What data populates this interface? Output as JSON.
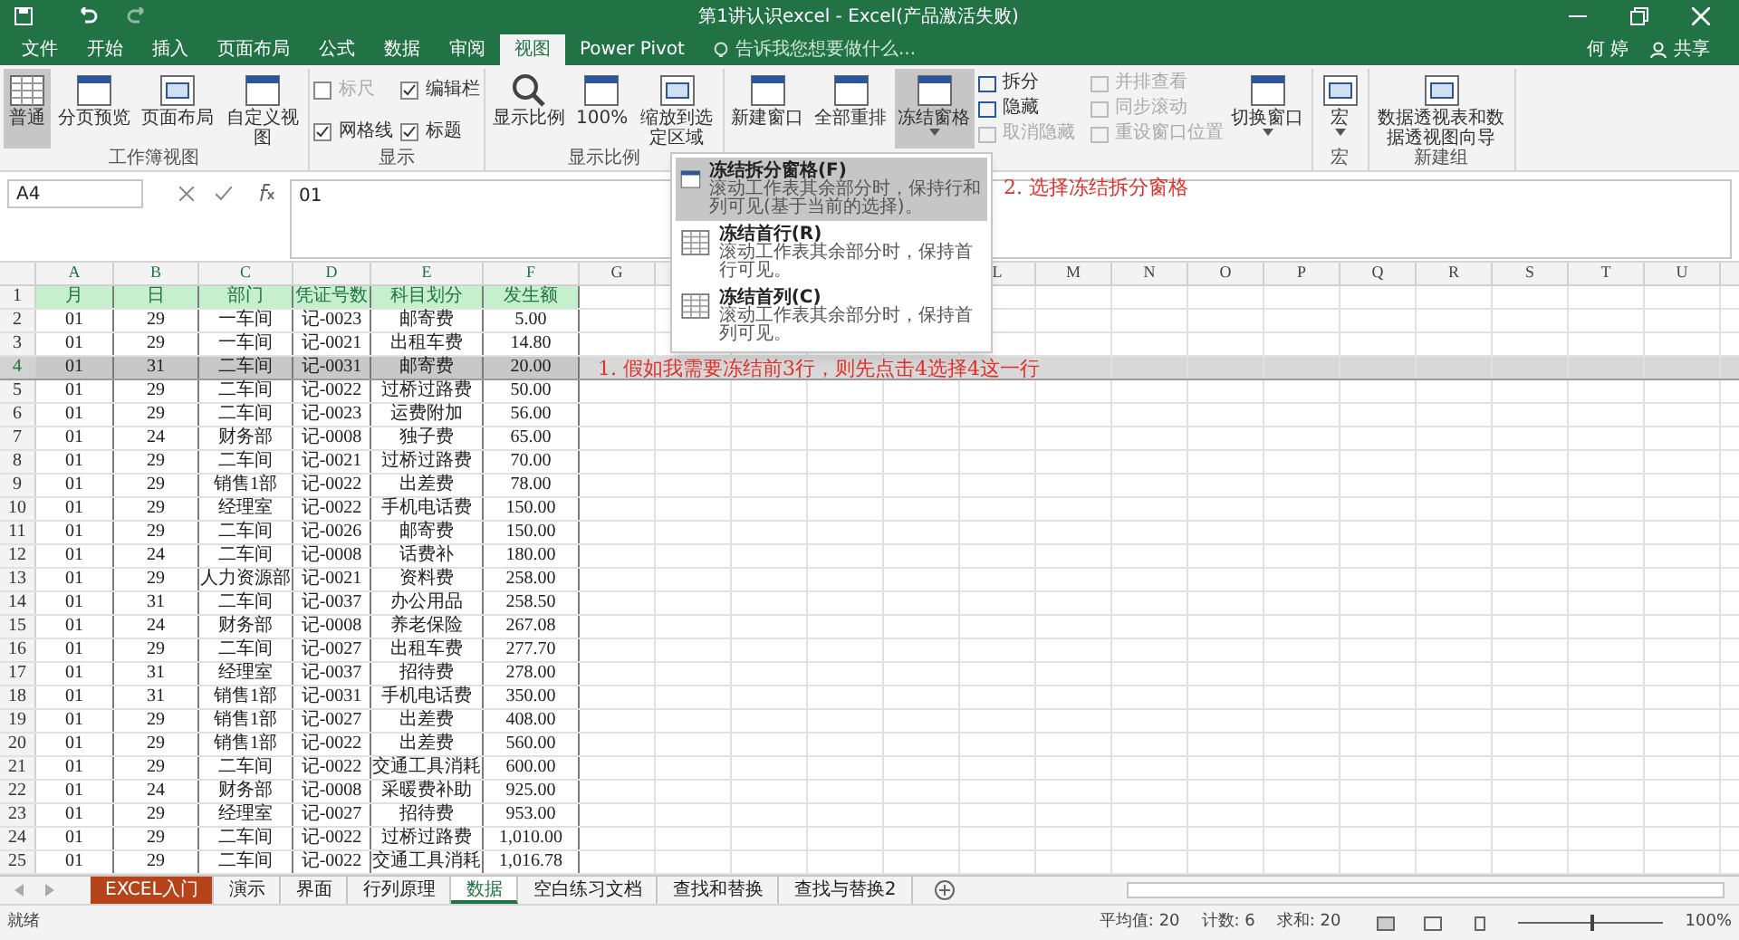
{
  "title_bar": {
    "title": "第1讲认识excel - Excel(产品激活失败)",
    "user": "何 婷",
    "share": "共享"
  },
  "menu_tabs": [
    {
      "label": "文件",
      "selected": false
    },
    {
      "label": "开始",
      "selected": false
    },
    {
      "label": "插入",
      "selected": false
    },
    {
      "label": "页面布局",
      "selected": false
    },
    {
      "label": "公式",
      "selected": false
    },
    {
      "label": "数据",
      "selected": false
    },
    {
      "label": "审阅",
      "selected": false
    },
    {
      "label": "视图",
      "selected": true
    },
    {
      "label": "Power Pivot",
      "selected": false
    }
  ],
  "tell_me": {
    "placeholder": "告诉我您想要做什么..."
  },
  "ribbon_groups": [
    {
      "label": "工作簿视图",
      "items": [
        {
          "kind": "large",
          "label": "普通",
          "selected": true
        },
        {
          "kind": "large",
          "label": "分页预览",
          "selected": false
        },
        {
          "kind": "large",
          "label": "页面布局",
          "selected": false
        },
        {
          "kind": "large",
          "label": "自定义视图",
          "selected": false
        }
      ]
    },
    {
      "label": "显示",
      "items": [
        {
          "kind": "check",
          "label": "标尺",
          "checked": false,
          "disabled": true
        },
        {
          "kind": "check",
          "label": "编辑栏",
          "checked": true,
          "disabled": false
        },
        {
          "kind": "check",
          "label": "网格线",
          "checked": true,
          "disabled": false
        },
        {
          "kind": "check",
          "label": "标题",
          "checked": true,
          "disabled": false
        }
      ]
    },
    {
      "label": "显示比例",
      "items": [
        {
          "kind": "large",
          "label": "显示比例",
          "selected": false
        },
        {
          "kind": "large",
          "label": "100%",
          "selected": false
        },
        {
          "kind": "large",
          "label": "缩放到选定区域",
          "selected": false
        }
      ]
    },
    {
      "items": [
        {
          "kind": "large",
          "label": "新建窗口",
          "selected": false
        },
        {
          "kind": "large",
          "label": "全部重排",
          "selected": false
        },
        {
          "kind": "large",
          "label": "冻结窗格",
          "selected": true,
          "has_menu": true
        },
        {
          "kind": "small",
          "label": "拆分",
          "disabled": false
        },
        {
          "kind": "small",
          "label": "隐藏",
          "disabled": false
        },
        {
          "kind": "small",
          "label": "取消隐藏",
          "disabled": true
        },
        {
          "kind": "small",
          "label": "并排查看",
          "disabled": true
        },
        {
          "kind": "small",
          "label": "同步滚动",
          "disabled": true
        },
        {
          "kind": "small",
          "label": "重设窗口位置",
          "disabled": true
        },
        {
          "kind": "large",
          "label": "切换窗口",
          "selected": false,
          "has_menu": true
        }
      ]
    },
    {
      "label": "宏",
      "items": [
        {
          "kind": "large",
          "label": "宏",
          "selected": false,
          "has_menu": true
        }
      ]
    },
    {
      "label": "新建组",
      "items": [
        {
          "kind": "large",
          "label": "数据透视表和数据透视图向导",
          "selected": false
        }
      ]
    }
  ],
  "formula_bar": {
    "name_box": "A4",
    "value": "01"
  },
  "columns": [
    "A",
    "B",
    "C",
    "D",
    "E",
    "F",
    "G",
    "L",
    "M",
    "N",
    "O",
    "P",
    "Q",
    "R",
    "S",
    "T",
    "U"
  ],
  "rows": [
    {
      "number": "1",
      "kind": "header",
      "selected": false,
      "cells": [
        "月",
        "日",
        "部门",
        "凭证号数",
        "科目划分",
        "发生额"
      ]
    },
    {
      "number": "2",
      "kind": "data",
      "selected": false,
      "cells": [
        "01",
        "29",
        "一车间",
        "记-0023",
        "邮寄费",
        "5.00"
      ]
    },
    {
      "number": "3",
      "kind": "data",
      "selected": false,
      "cells": [
        "01",
        "29",
        "一车间",
        "记-0021",
        "出租车费",
        "14.80"
      ]
    },
    {
      "number": "4",
      "kind": "data",
      "selected": true,
      "cells": [
        "01",
        "31",
        "二车间",
        "记-0031",
        "邮寄费",
        "20.00"
      ]
    },
    {
      "number": "5",
      "kind": "data",
      "selected": false,
      "cells": [
        "01",
        "29",
        "二车间",
        "记-0022",
        "过桥过路费",
        "50.00"
      ]
    },
    {
      "number": "6",
      "kind": "data",
      "selected": false,
      "cells": [
        "01",
        "29",
        "二车间",
        "记-0023",
        "运费附加",
        "56.00"
      ]
    },
    {
      "number": "7",
      "kind": "data",
      "selected": false,
      "cells": [
        "01",
        "24",
        "财务部",
        "记-0008",
        "独子费",
        "65.00"
      ]
    },
    {
      "number": "8",
      "kind": "data",
      "selected": false,
      "cells": [
        "01",
        "29",
        "二车间",
        "记-0021",
        "过桥过路费",
        "70.00"
      ]
    },
    {
      "number": "9",
      "kind": "data",
      "selected": false,
      "cells": [
        "01",
        "29",
        "销售1部",
        "记-0022",
        "出差费",
        "78.00"
      ]
    },
    {
      "number": "10",
      "kind": "data",
      "selected": false,
      "cells": [
        "01",
        "29",
        "经理室",
        "记-0022",
        "手机电话费",
        "150.00"
      ]
    },
    {
      "number": "11",
      "kind": "data",
      "selected": false,
      "cells": [
        "01",
        "29",
        "二车间",
        "记-0026",
        "邮寄费",
        "150.00"
      ]
    },
    {
      "number": "12",
      "kind": "data",
      "selected": false,
      "cells": [
        "01",
        "24",
        "二车间",
        "记-0008",
        "话费补",
        "180.00"
      ]
    },
    {
      "number": "13",
      "kind": "data",
      "selected": false,
      "cells": [
        "01",
        "29",
        "人力资源部",
        "记-0021",
        "资料费",
        "258.00"
      ]
    },
    {
      "number": "14",
      "kind": "data",
      "selected": false,
      "cells": [
        "01",
        "31",
        "二车间",
        "记-0037",
        "办公用品",
        "258.50"
      ]
    },
    {
      "number": "15",
      "kind": "data",
      "selected": false,
      "cells": [
        "01",
        "24",
        "财务部",
        "记-0008",
        "养老保险",
        "267.08"
      ]
    },
    {
      "number": "16",
      "kind": "data",
      "selected": false,
      "cells": [
        "01",
        "29",
        "二车间",
        "记-0027",
        "出租车费",
        "277.70"
      ]
    },
    {
      "number": "17",
      "kind": "data",
      "selected": false,
      "cells": [
        "01",
        "31",
        "经理室",
        "记-0037",
        "招待费",
        "278.00"
      ]
    },
    {
      "number": "18",
      "kind": "data",
      "selected": false,
      "cells": [
        "01",
        "31",
        "销售1部",
        "记-0031",
        "手机电话费",
        "350.00"
      ]
    },
    {
      "number": "19",
      "kind": "data",
      "selected": false,
      "cells": [
        "01",
        "29",
        "销售1部",
        "记-0027",
        "出差费",
        "408.00"
      ]
    },
    {
      "number": "20",
      "kind": "data",
      "selected": false,
      "cells": [
        "01",
        "29",
        "销售1部",
        "记-0022",
        "出差费",
        "560.00"
      ]
    },
    {
      "number": "21",
      "kind": "data",
      "selected": false,
      "cells": [
        "01",
        "29",
        "二车间",
        "记-0022",
        "交通工具消耗",
        "600.00"
      ]
    },
    {
      "number": "22",
      "kind": "data",
      "selected": false,
      "cells": [
        "01",
        "24",
        "财务部",
        "记-0008",
        "采暖费补助",
        "925.00"
      ]
    },
    {
      "number": "23",
      "kind": "data",
      "selected": false,
      "cells": [
        "01",
        "29",
        "经理室",
        "记-0027",
        "招待费",
        "953.00"
      ]
    },
    {
      "number": "24",
      "kind": "data",
      "selected": false,
      "cells": [
        "01",
        "29",
        "二车间",
        "记-0022",
        "过桥过路费",
        "1,010.00"
      ]
    },
    {
      "number": "25",
      "kind": "data",
      "selected": false,
      "cells": [
        "01",
        "29",
        "二车间",
        "记-0022",
        "交通工具消耗",
        "1,016.78"
      ]
    }
  ],
  "freeze_menu": {
    "items": [
      {
        "label": "冻结拆分窗格(F)",
        "description": "滚动工作表其余部分时，保持行和列可见(基于当前的选择)。",
        "selected": true
      },
      {
        "label": "冻结首行(R)",
        "description": "滚动工作表其余部分时，保持首行可见。",
        "selected": false
      },
      {
        "label": "冻结首列(C)",
        "description": "滚动工作表其余部分时，保持首列可见。",
        "selected": false
      }
    ]
  },
  "annotations": [
    "2. 选择冻结拆分窗格",
    "1. 假如我需要冻结前3行，则先点击4选择4这一行"
  ],
  "sheet_tabs": [
    {
      "label": "EXCEL入门",
      "selected": false,
      "color": "#b5441b"
    },
    {
      "label": "演示",
      "selected": false
    },
    {
      "label": "界面",
      "selected": false
    },
    {
      "label": "行列原理",
      "selected": false
    },
    {
      "label": "数据",
      "selected": true
    },
    {
      "label": "空白练习文档",
      "selected": false
    },
    {
      "label": "查找和替换",
      "selected": false
    },
    {
      "label": "查找与替换2",
      "selected": false
    }
  ],
  "status_bar": {
    "state": "就绪",
    "stats": [
      "平均值: 20",
      "计数: 6",
      "求和: 20"
    ],
    "zoom": "100%",
    "zoom_level": {
      "level": 0.5
    }
  }
}
